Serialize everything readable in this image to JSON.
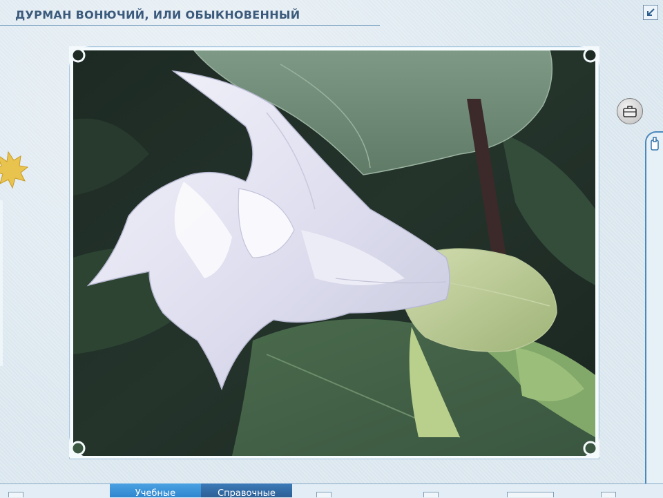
{
  "header": {
    "title": "ДУРМАН ВОНЮЧИЙ, ИЛИ ОБЫКНОВЕННЫЙ"
  },
  "toolbar": {
    "corner_icon": "arrow-down-left-icon",
    "side_button_icon": "briefcase-icon",
    "side_tab_icon": "clip-icon"
  },
  "tabs": [
    {
      "label": "Учебные"
    },
    {
      "label": "Справочные"
    }
  ],
  "colors": {
    "accent": "#3b5a7c",
    "tab_study": "#3b95db",
    "tab_reference": "#33689f",
    "background": "#dde9f1"
  },
  "content": {
    "image_subject": "white datura flower photo"
  }
}
